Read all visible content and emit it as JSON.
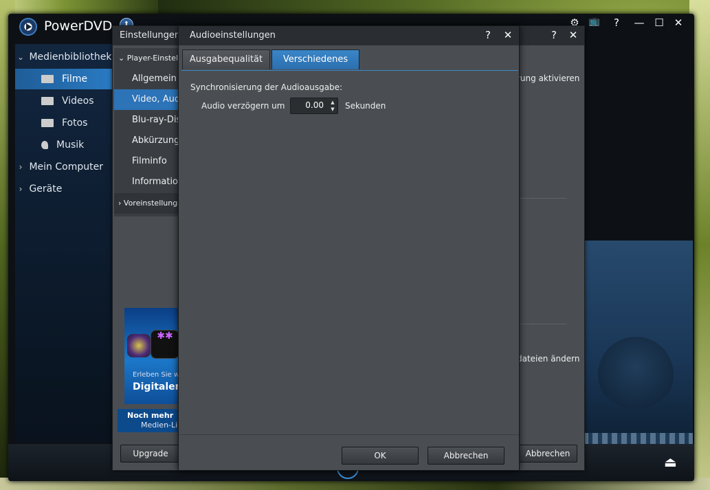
{
  "app": {
    "title": "PowerDVD",
    "update_badge": "⬆",
    "window_controls": [
      "⚙",
      "📺",
      "?",
      "—",
      "☐",
      "✕"
    ]
  },
  "sidebar": {
    "items": [
      {
        "label": "Medienbibliothek",
        "chevron": "⌄"
      },
      {
        "label": "Filme",
        "icon": "film-icon"
      },
      {
        "label": "Videos",
        "icon": "video-camera-icon"
      },
      {
        "label": "Fotos",
        "icon": "photo-icon"
      },
      {
        "label": "Musik",
        "icon": "music-note-icon"
      },
      {
        "label": "Mein Computer",
        "chevron": "›"
      },
      {
        "label": "Geräte",
        "chevron": "›"
      }
    ]
  },
  "settings_dialog": {
    "title": "Einstellungen",
    "help": "?",
    "close": "✕",
    "nav": [
      {
        "label": "Player-Einstellungen",
        "chevron": "⌄"
      },
      {
        "label": "Allgemein"
      },
      {
        "label": "Video, Audio, Untertitel"
      },
      {
        "label": "Blu-ray-Disc"
      },
      {
        "label": "Abkürzungen"
      },
      {
        "label": "Filminfo"
      },
      {
        "label": "Informationen"
      },
      {
        "label": "Voreinstellungen",
        "chevron": "›"
      }
    ],
    "bg_text_1": "rung aktivieren",
    "bg_text_2": "dateien ändern",
    "promo": {
      "line1": "Erleben Sie w",
      "line2": "Digitalen",
      "strip_line1": "Noch mehr",
      "strip_line2": "Medien-Li"
    },
    "upgrade_label": "Upgrade",
    "cancel_label": "Abbrechen"
  },
  "audio_dialog": {
    "title": "Audioeinstellungen",
    "help": "?",
    "close": "✕",
    "tabs": [
      {
        "label": "Ausgabequalität"
      },
      {
        "label": "Verschiedenes",
        "selected": true
      }
    ],
    "sync_label": "Synchronisierung der Audioausgabe:",
    "delay_label": "Audio verzögern um",
    "delay_value": "0.00",
    "unit_label": "Sekunden",
    "ok_label": "OK",
    "cancel_label": "Abbrechen"
  },
  "main": {
    "eject": "⏏"
  },
  "colors": {
    "accent": "#2c73b8",
    "dialog_bg": "#4a4e52",
    "title_bg": "#2a2e33"
  }
}
